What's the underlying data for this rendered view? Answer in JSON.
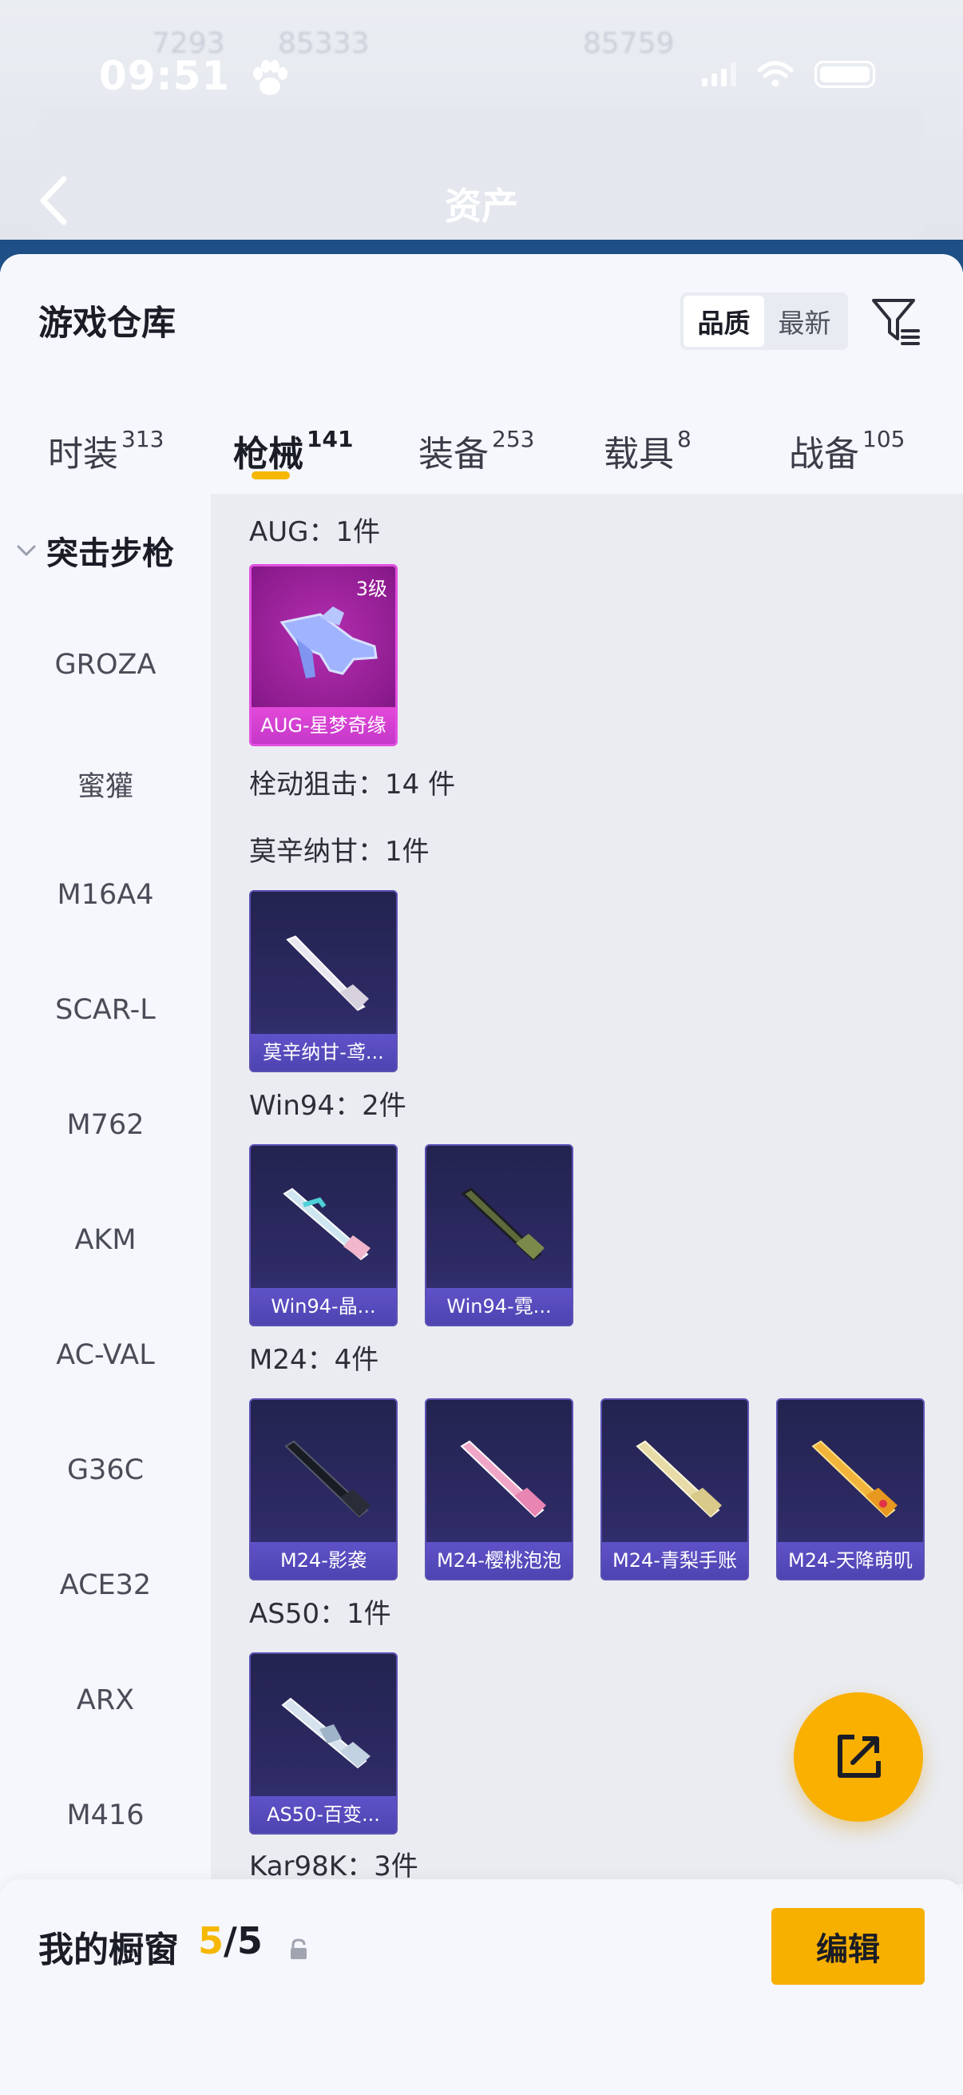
{
  "status": {
    "time": "09:51"
  },
  "header": {
    "title": "资产"
  },
  "sheet": {
    "title": "游戏仓库",
    "sort": {
      "options": [
        "品质",
        "最新"
      ],
      "selected": "品质"
    }
  },
  "tabs": [
    {
      "label": "时装",
      "count": "313"
    },
    {
      "label": "枪械",
      "count": "141",
      "active": true
    },
    {
      "label": "装备",
      "count": "253"
    },
    {
      "label": "载具",
      "count": "8"
    },
    {
      "label": "战备",
      "count": "105"
    }
  ],
  "sidebar": {
    "category": "突击步枪",
    "items": [
      "GROZA",
      "蜜獾",
      "M16A4",
      "SCAR-L",
      "M762",
      "AKM",
      "AC-VAL",
      "G36C",
      "ACE32",
      "ARX",
      "M416"
    ]
  },
  "groups": [
    {
      "label": "AUG：1件",
      "items": [
        {
          "name": "AUG-星梦奇缘",
          "level": "3级",
          "rarity": "pink"
        }
      ]
    },
    {
      "label": "栓动狙击：14 件"
    },
    {
      "label": "莫辛纳甘：1件",
      "items": [
        {
          "name": "莫辛纳甘-鸢..."
        }
      ]
    },
    {
      "label": "Win94：2件",
      "items": [
        {
          "name": "Win94-晶..."
        },
        {
          "name": "Win94-霓..."
        }
      ]
    },
    {
      "label": "M24：4件",
      "items": [
        {
          "name": "M24-影袭"
        },
        {
          "name": "M24-樱桃泡泡"
        },
        {
          "name": "M24-青梨手账"
        },
        {
          "name": "M24-天降萌叽"
        }
      ]
    },
    {
      "label": "AS50：1件",
      "items": [
        {
          "name": "AS50-百变..."
        }
      ]
    },
    {
      "label": "Kar98K：3件"
    }
  ],
  "bottom": {
    "label": "我的橱窗",
    "count_current": "5",
    "count_total": "/5",
    "edit_label": "编辑"
  },
  "colors": {
    "accent": "#f5b700",
    "card_purple": "#4e44b0",
    "card_pink": "#c438c9"
  },
  "icons": [
    "back-arrow-icon",
    "filter-icon",
    "chevron-down-icon",
    "lock-icon",
    "share-out-icon",
    "paw-icon"
  ]
}
